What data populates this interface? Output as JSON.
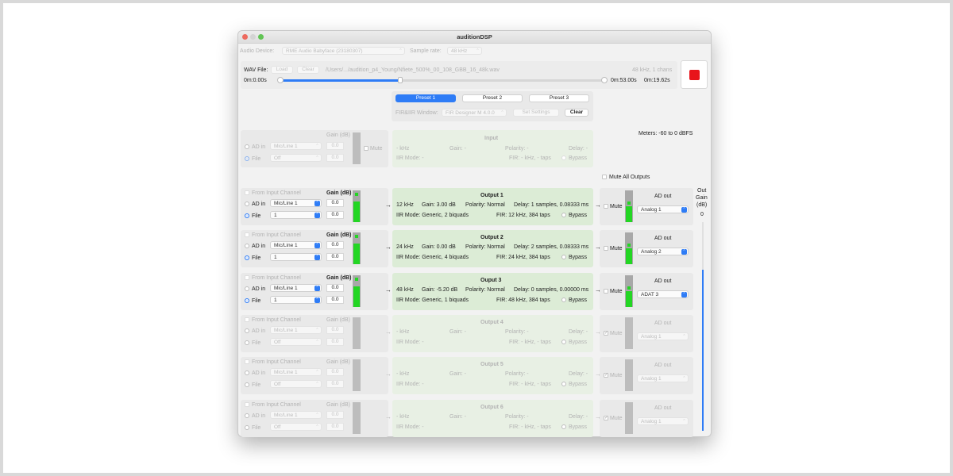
{
  "window": {
    "title": "auditionDSP"
  },
  "device": {
    "label": "Audio Device:",
    "value": "RME Audio Babyface (23180307)",
    "rate_label": "Sample rate:",
    "rate_value": "48 kHz"
  },
  "wav": {
    "label": "WAV File:",
    "load": "Load",
    "clear": "Clear",
    "path": "/Users/.../audition_p4_Young/Nfiete_500%_00_108_GBB_16_48k.wav",
    "info": "48 kHz, 1 chans",
    "pos_start": "0m:0.00s",
    "pos_end": "0m:53.00s",
    "remaining": "0m:19.62s",
    "progress_percent": 37
  },
  "presets": {
    "p1": "Preset 1",
    "p2": "Preset 2",
    "p3": "Preset 3"
  },
  "fir": {
    "label": "FIR&IIR Window:",
    "value": "FIR Designer M 4.0.0",
    "set": "Set Settings",
    "clear": "Clear"
  },
  "meters_label": "Meters: -60 to 0 dBFS",
  "mute_all": "Mute All Outputs",
  "labels": {
    "ad_in": "AD in",
    "file": "File",
    "gain": "Gain (dB)",
    "mute": "Mute",
    "from_input": "From Input Channel",
    "ad_out": "AD out",
    "bypass": "Bypass",
    "arrow": "→"
  },
  "out_gain": {
    "label1": "Out",
    "label2": "Gain",
    "label3": "(dB)",
    "value": "0"
  },
  "input": {
    "title": "Input",
    "ad_source": "Mic/Line 1",
    "file_source": "Off",
    "gain1": "0.0",
    "gain2": "0.0",
    "line1": "- kHz",
    "gain": "Gain: -",
    "polarity": "Polarity: -",
    "delay": "Delay: -",
    "iir": "IIR Mode: -",
    "fir": "FIR: - kHz, - taps"
  },
  "outputs": [
    {
      "title": "Output 1",
      "ad_source": "Mic/Line 1",
      "file_source": "1",
      "gain1": "0.0",
      "gain2": "0.0",
      "freq": "12 kHz",
      "gain": "Gain:  3.00 dB",
      "polarity": "Polarity: Normal",
      "delay": "Delay: 1 samples, 0.08333 ms",
      "iir": "IIR Mode: Generic, 2 biquads",
      "fir": "FIR: 12 kHz, 384 taps",
      "ad_out": "Analog 1",
      "level": 0.85
    },
    {
      "title": "Output 2",
      "ad_source": "Mic/Line 1",
      "file_source": "1",
      "gain1": "0.0",
      "gain2": "0.0",
      "freq": "24 kHz",
      "gain": "Gain:  0.00 dB",
      "polarity": "Polarity: Normal",
      "delay": "Delay: 2 samples, 0.08333 ms",
      "iir": "IIR Mode: Generic, 4 biquads",
      "fir": "FIR: 24 kHz, 384 taps",
      "ad_out": "Analog 2",
      "level": 0.85
    },
    {
      "title": "Ouput 3",
      "ad_source": "Mic/Line 1",
      "file_source": "1",
      "gain1": "0.0",
      "gain2": "0.0",
      "freq": "48 kHz",
      "gain": "Gain: -5.20 dB",
      "polarity": "Polarity: Normal",
      "delay": "Delay: 0 samples, 0.00000 ms",
      "iir": "IIR Mode: Generic, 1 biquads",
      "fir": "FIR: 48 kHz, 384 taps",
      "ad_out": "ADAT 3",
      "level": 0.85
    },
    {
      "title": "Output 4",
      "ad_source": "Mic/Line 1",
      "file_source": "Off",
      "gain1": "0.0",
      "gain2": "0.0",
      "freq": "- kHz",
      "gain": "Gain: -",
      "polarity": "Polarity: -",
      "delay": "Delay: -",
      "iir": "IIR Mode: -",
      "fir": "FIR: - kHz, - taps",
      "ad_out": "Analog 1",
      "level": 0
    },
    {
      "title": "Output 5",
      "ad_source": "Mic/Line 1",
      "file_source": "Off",
      "gain1": "0.0",
      "gain2": "0.0",
      "freq": "- kHz",
      "gain": "Gain: -",
      "polarity": "Polarity: -",
      "delay": "Delay: -",
      "iir": "IIR Mode: -",
      "fir": "FIR: - kHz, - taps",
      "ad_out": "Analog 1",
      "level": 0
    },
    {
      "title": "Output 6",
      "ad_source": "Mic/Line 1",
      "file_source": "Off",
      "gain1": "0.0",
      "gain2": "0.0",
      "freq": "- kHz",
      "gain": "Gain: -",
      "polarity": "Polarity: -",
      "delay": "Delay: -",
      "iir": "IIR Mode: -",
      "fir": "FIR: - kHz, - taps",
      "ad_out": "Analog 1",
      "level": 0
    }
  ],
  "colors": {
    "accent": "#2e7cf6",
    "meter_green": "#23d623",
    "stop_red": "#e8141b",
    "panel_green": "#dcecd6"
  }
}
